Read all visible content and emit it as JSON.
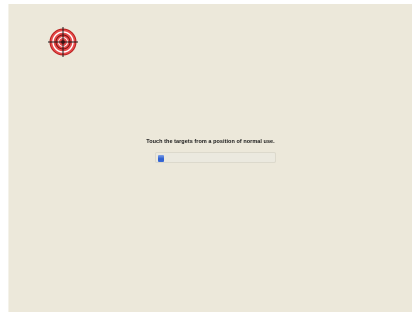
{
  "calibration": {
    "instruction": "Touch the targets from a position of normal use.",
    "progress_fraction": 0.05,
    "target_color": "#d92b2b",
    "target_icon": "crosshair-target-icon"
  },
  "colors": {
    "background": "#ece8da",
    "progress_fill": "#2e5fcf"
  }
}
